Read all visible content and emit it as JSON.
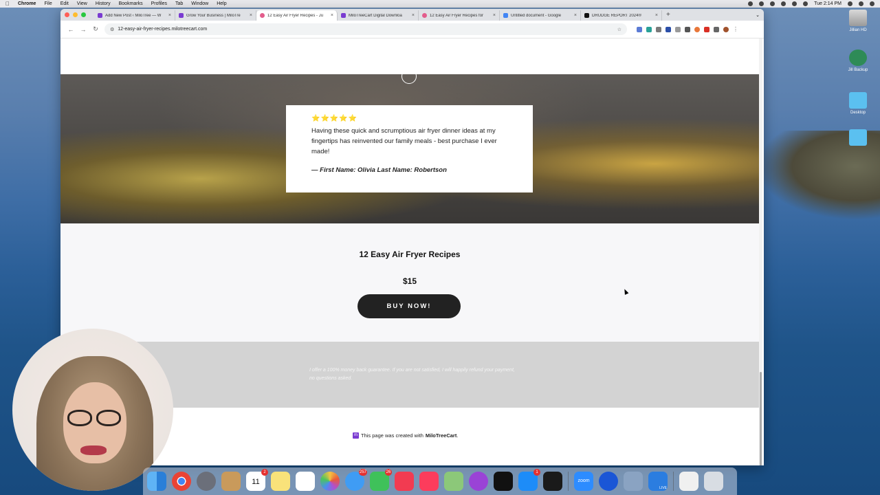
{
  "menubar": {
    "app": "Chrome",
    "items": [
      "File",
      "Edit",
      "View",
      "History",
      "Bookmarks",
      "Profiles",
      "Tab",
      "Window",
      "Help"
    ],
    "clock": "Tue 2:14 PM"
  },
  "desktop": {
    "icons": [
      {
        "label": "Jillian HD",
        "icon": "hard-drive-icon"
      },
      {
        "label": "Jill Backup",
        "icon": "time-machine-icon"
      },
      {
        "label": "Desktop",
        "icon": "folder-icon"
      },
      {
        "label": "",
        "icon": "folder-icon"
      }
    ]
  },
  "browser": {
    "tabs": [
      {
        "title": "Add New Post ‹ MiloTree — W",
        "active": false
      },
      {
        "title": "Grow Your Business | MiloTre",
        "active": false
      },
      {
        "title": "12 Easy Air Fryer Recipes - Ju",
        "active": true
      },
      {
        "title": "MiloTreeCart Digital Downloa",
        "active": false
      },
      {
        "title": "12 Easy Air Fryer Recipes for",
        "active": false
      },
      {
        "title": "Untitled document - Google",
        "active": false
      },
      {
        "title": "DRUDGE REPORT 2024®",
        "active": false
      }
    ],
    "url": "12-easy-air-fryer-recipes.milotreecart.com"
  },
  "testimonial": {
    "stars": "⭐⭐⭐⭐⭐",
    "text": "Having these quick and scrumptious air fryer dinner ideas at my fingertips has reinvented our family meals - best purchase I ever made!",
    "author": "— First Name: Olivia Last Name: Robertson"
  },
  "product": {
    "title": "12 Easy Air Fryer Recipes",
    "price": "$15",
    "buy_label": "BUY NOW!"
  },
  "guarantee": {
    "text": "I offer a 100% money back guarantee. If you are not satisfied, I will happily refund your payment, no questions asked."
  },
  "footer": {
    "prefix": "This page was created with",
    "brand": "MiloTreeCart",
    "suffix": "."
  },
  "dock": {
    "badges": {
      "calendar_day": "11",
      "calendar_month": "JUN",
      "calendar_badge": "2",
      "messages_badge": "257",
      "facetime_badge": "26",
      "appstore_badge": "1",
      "zoom_label": "zoom",
      "live_label": "LIVE"
    }
  },
  "colors": {
    "accent_purple": "#7a3bd1",
    "button_dark": "#222222",
    "star_gold": "#f4b400",
    "guarantee_bg": "#d3d3d3"
  }
}
